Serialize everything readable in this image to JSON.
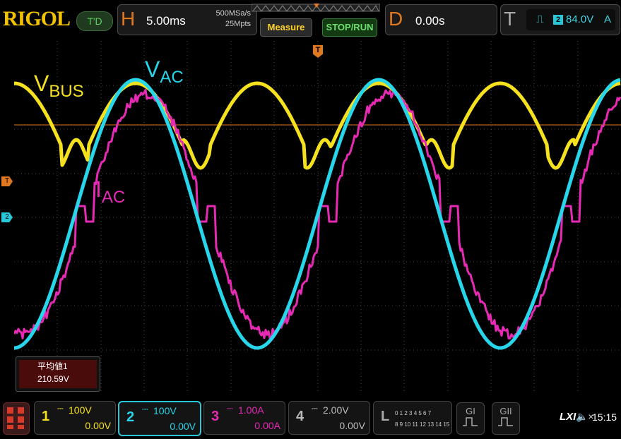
{
  "topbar": {
    "logo": "RIGOL",
    "trigger_state": "T'D",
    "horizontal": {
      "letter": "H",
      "timebase": "5.00ms",
      "sample_rate": "500MSa/s",
      "memory_depth": "25Mpts"
    },
    "measure_label": "Measure",
    "stoprun_label": "STOP/RUN",
    "delay": {
      "letter": "D",
      "value": "0.00s"
    },
    "trigger": {
      "letter": "T",
      "source": "2",
      "level": "84.0V",
      "mode": "A"
    }
  },
  "screen": {
    "trigger_position_marker": "T",
    "trigger_level_marker": "T",
    "ch2_marker": "2",
    "labels": {
      "vbus": {
        "main": "V",
        "sub": "BUS",
        "color": "#f5e11e"
      },
      "vac": {
        "main": "V",
        "sub": "AC",
        "color": "#27d6ea"
      },
      "iac": {
        "main": "I",
        "sub": "AC",
        "color": "#e62ab4"
      }
    },
    "measurement": {
      "name": "平均値1",
      "value": "210.59V"
    }
  },
  "channels": [
    {
      "number": "1",
      "scale": "100V",
      "offset": "0.00V",
      "color": "#f5e11e"
    },
    {
      "number": "2",
      "scale": "100V",
      "offset": "0.00V",
      "color": "#27d6ea"
    },
    {
      "number": "3",
      "scale": "1.00A",
      "offset": "0.00A",
      "color": "#e62ab4"
    },
    {
      "number": "4",
      "scale": "2.00V",
      "offset": "0.00V",
      "color": "#999999"
    }
  ],
  "logic": {
    "letter": "L",
    "row1": "0 1 2 3  4 5 6 7",
    "row2": "8 9 10 11 12 13 14 15"
  },
  "generators": [
    {
      "label": "GI"
    },
    {
      "label": "GII"
    }
  ],
  "status": {
    "lxi": "LXI",
    "speaker": "🔈×",
    "time": "15:15"
  }
}
